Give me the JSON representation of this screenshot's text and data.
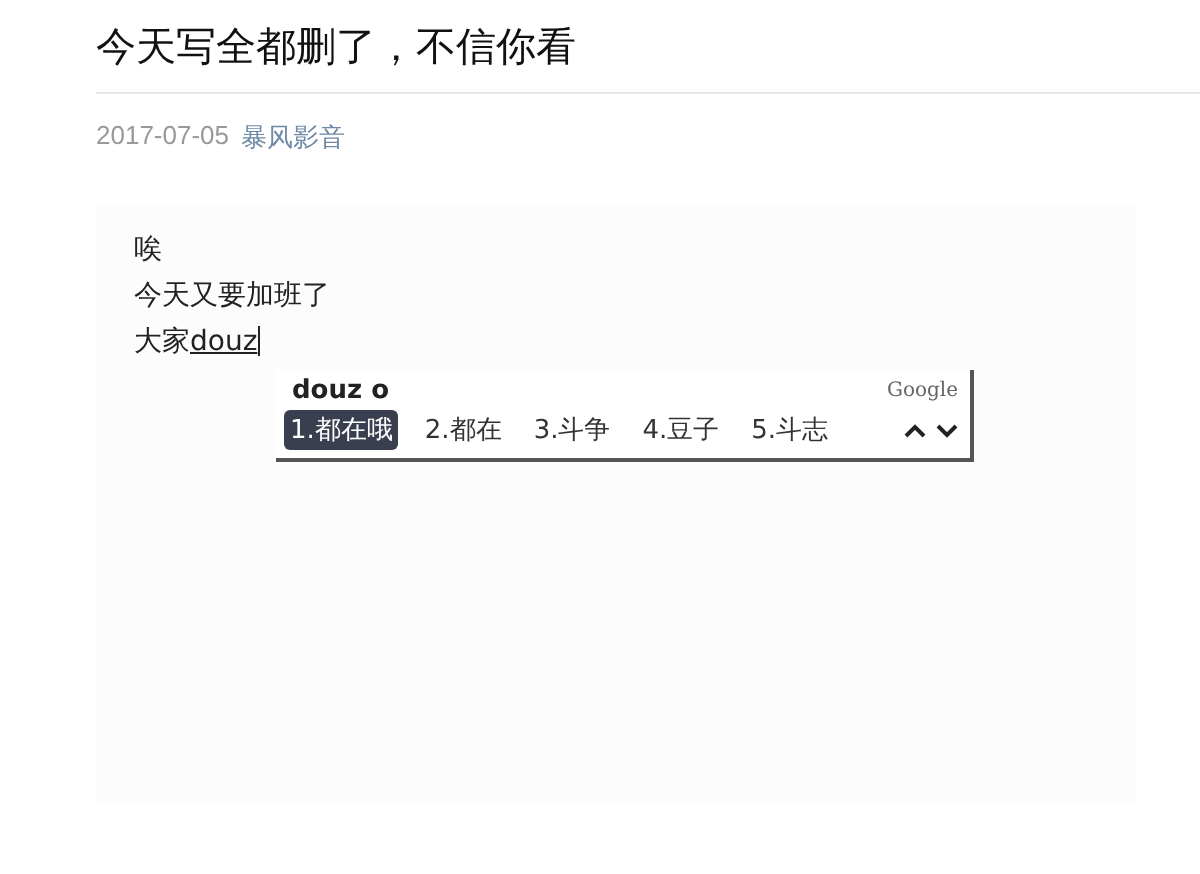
{
  "article": {
    "title": "今天写全都删了，不信你看",
    "date": "2017-07-05",
    "source": "暴风影音"
  },
  "editor": {
    "lines": [
      "唉",
      "今天又要加班了"
    ],
    "committed": "大家",
    "composing": "douz"
  },
  "ime": {
    "pinyin": "douz o",
    "brand": "Google",
    "candidates": [
      {
        "label": "1.都在哦",
        "selected": true
      },
      {
        "label": "2.都在",
        "selected": false
      },
      {
        "label": "3.斗争",
        "selected": false
      },
      {
        "label": "4.豆子",
        "selected": false
      },
      {
        "label": "5.斗志",
        "selected": false
      }
    ]
  }
}
